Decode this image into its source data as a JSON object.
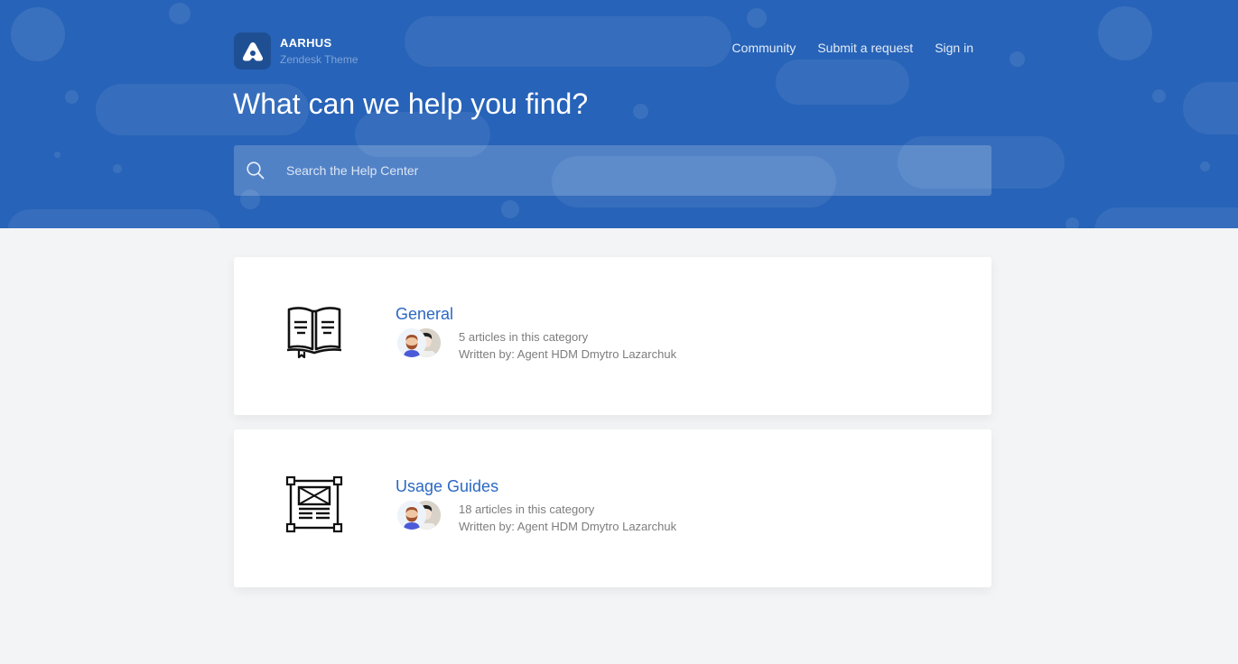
{
  "brand": {
    "name": "AARHUS",
    "subtitle": "Zendesk Theme",
    "logo_icon": "aarhus-logo-icon"
  },
  "nav": {
    "items": [
      {
        "label": "Community"
      },
      {
        "label": "Submit a request"
      },
      {
        "label": "Sign in"
      }
    ]
  },
  "hero": {
    "title": "What can we help you find?"
  },
  "search": {
    "icon": "search-icon",
    "placeholder": "Search the Help Center",
    "value": ""
  },
  "categories": [
    {
      "title": "General",
      "icon": "open-book-icon",
      "article_count": "5 articles in this category",
      "written_by": "Written by: Agent HDM Dmytro Lazarchuk"
    },
    {
      "title": "Usage Guides",
      "icon": "layout-wireframe-icon",
      "article_count": "18 articles in this category",
      "written_by": "Written by: Agent HDM Dmytro Lazarchuk"
    }
  ],
  "colors": {
    "hero_bg": "#2763b8",
    "link": "#2b68c4",
    "page_bg": "#f3f4f6"
  }
}
